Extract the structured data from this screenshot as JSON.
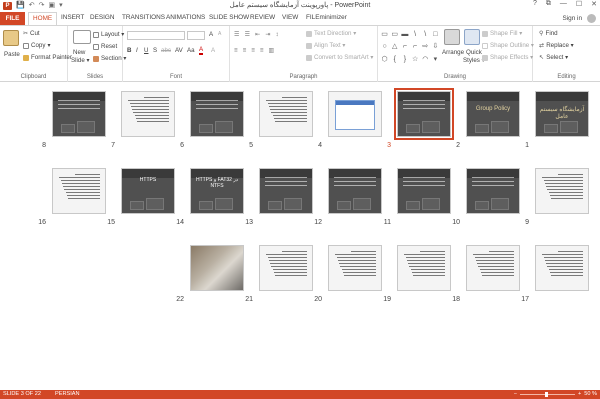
{
  "window": {
    "title": "پاورپوینت آزمایشگاه سیستم عامل - PowerPoint",
    "app_icon": "P",
    "qat": {
      "save": "💾",
      "undo": "↶",
      "redo": "↷",
      "present": "▣",
      "customize": "▾"
    },
    "controls": {
      "help": "?",
      "ribbon_display": "⧉",
      "minimize": "—",
      "maximize": "☐",
      "close": "✕"
    }
  },
  "tabs": [
    "FILE",
    "HOME",
    "INSERT",
    "DESIGN",
    "TRANSITIONS",
    "ANIMATIONS",
    "SLIDE SHOW",
    "REVIEW",
    "VIEW",
    "FILEminimizer"
  ],
  "active_tab": "HOME",
  "sign_in": "Sign in",
  "ribbon": {
    "clipboard": {
      "label": "Clipboard",
      "paste": "Paste",
      "cut": "Cut",
      "copy": "Copy",
      "copy_arrow": "▾",
      "format_painter": "Format Painter"
    },
    "slides": {
      "label": "Slides",
      "new_slide": "New",
      "new_slide2": "Slide ▾",
      "layout": "Layout ▾",
      "reset": "Reset",
      "section": "Section ▾"
    },
    "font": {
      "label": "Font",
      "bold": "B",
      "italic": "I",
      "underline": "U",
      "strike": "S",
      "shadow": "S",
      "abc": "abc",
      "av": "AV",
      "aa": "Aa",
      "grow": "A",
      "shrink": "A",
      "clear": "A",
      "color": "A"
    },
    "paragraph": {
      "label": "Paragraph",
      "text_direction": "Text Direction ▾",
      "align_text": "Align Text ▾",
      "smartart": "Convert to SmartArt ▾"
    },
    "drawing": {
      "label": "Drawing",
      "arrange": "Arrange",
      "quick_styles": "Quick",
      "quick_styles2": "Styles ▾",
      "shape_fill": "Shape Fill ▾",
      "shape_outline": "Shape Outline ▾",
      "shape_effects": "Shape Effects ▾",
      "shapes": [
        "▭",
        "▭",
        "▬",
        "\\",
        "\\",
        "□",
        "○",
        "△",
        "⌐",
        "⌐",
        "⇨",
        "⇩",
        "⬡",
        "{",
        "}",
        "☆",
        "◠",
        "▾"
      ]
    },
    "editing": {
      "label": "Editing",
      "find": "Find",
      "replace": "Replace ▾",
      "select": "Select ▾"
    }
  },
  "slides": [
    {
      "n": "1",
      "style": "gold",
      "text": "آزمایشگاه سیستم عامل"
    },
    {
      "n": "2",
      "style": "gold",
      "text": "Group Policy"
    },
    {
      "n": "3",
      "style": "dark",
      "text": "",
      "selected": true
    },
    {
      "n": "4",
      "style": "screen",
      "text": ""
    },
    {
      "n": "5",
      "style": "light",
      "text": ""
    },
    {
      "n": "6",
      "style": "dark",
      "text": ""
    },
    {
      "n": "7",
      "style": "light",
      "text": ""
    },
    {
      "n": "8",
      "style": "dark",
      "text": ""
    },
    {
      "n": "9",
      "style": "light",
      "text": ""
    },
    {
      "n": "10",
      "style": "dark",
      "text": ""
    },
    {
      "n": "11",
      "style": "dark",
      "text": ""
    },
    {
      "n": "12",
      "style": "dark",
      "text": ""
    },
    {
      "n": "13",
      "style": "dark",
      "text": ""
    },
    {
      "n": "14",
      "style": "dark",
      "text": "HTTPS و FAT32 در NTFS"
    },
    {
      "n": "15",
      "style": "dark",
      "text": "HTTPS"
    },
    {
      "n": "16",
      "style": "light",
      "text": ""
    },
    {
      "n": "17",
      "style": "light",
      "text": ""
    },
    {
      "n": "18",
      "style": "light",
      "text": ""
    },
    {
      "n": "19",
      "style": "light",
      "text": ""
    },
    {
      "n": "20",
      "style": "light",
      "text": ""
    },
    {
      "n": "21",
      "style": "light",
      "text": ""
    },
    {
      "n": "22",
      "style": "photo",
      "text": ""
    }
  ],
  "status": {
    "slide": "SLIDE 3 OF 22",
    "language": "PERSIAN",
    "zoom_minus": "−",
    "zoom_plus": "+",
    "zoom": "50 %",
    "zoom_value_percent": 50
  }
}
